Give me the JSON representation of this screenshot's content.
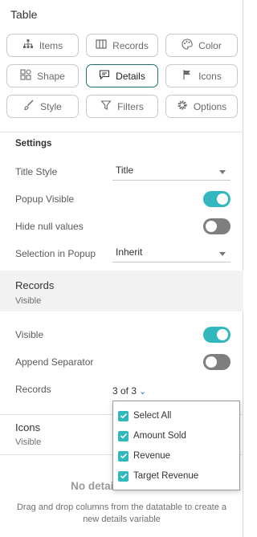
{
  "panel": {
    "title": "Table"
  },
  "tabs": [
    {
      "label": "Items",
      "icon": "hierarchy-icon",
      "active": false
    },
    {
      "label": "Records",
      "icon": "columns-icon",
      "active": false
    },
    {
      "label": "Color",
      "icon": "palette-icon",
      "active": false
    },
    {
      "label": "Shape",
      "icon": "shapes-icon",
      "active": false
    },
    {
      "label": "Details",
      "icon": "comment-icon",
      "active": true
    },
    {
      "label": "Icons",
      "icon": "flag-icon",
      "active": false
    },
    {
      "label": "Style",
      "icon": "brush-icon",
      "active": false
    },
    {
      "label": "Filters",
      "icon": "filter-icon",
      "active": false
    },
    {
      "label": "Options",
      "icon": "gear-icon",
      "active": false
    }
  ],
  "settings": {
    "heading": "Settings",
    "title_style_label": "Title Style",
    "title_style_value": "Title",
    "popup_visible_label": "Popup Visible",
    "popup_visible_on": true,
    "hide_null_label": "Hide null values",
    "hide_null_on": false,
    "selection_label": "Selection in Popup",
    "selection_value": "Inherit"
  },
  "records": {
    "title": "Records",
    "subtitle": "Visible",
    "visible_label": "Visible",
    "visible_on": true,
    "append_label": "Append Separator",
    "append_on": false,
    "records_label": "Records",
    "records_count": "3 of 3",
    "options": [
      {
        "label": "Select All",
        "checked": true
      },
      {
        "label": "Amount Sold",
        "checked": true
      },
      {
        "label": "Revenue",
        "checked": true
      },
      {
        "label": "Target Revenue",
        "checked": true
      }
    ]
  },
  "icons": {
    "title": "Icons",
    "subtitle": "Visible"
  },
  "empty_state": {
    "title": "No details variables",
    "description": "Drag and drop columns from the datatable to create a new details variable"
  },
  "colors": {
    "accent": "#30b8bd",
    "active_border": "#1f6e73",
    "toggle_off": "#7e7e7e"
  }
}
